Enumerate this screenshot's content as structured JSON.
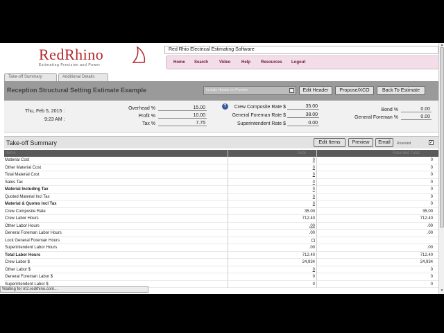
{
  "header": {
    "logo_text": "RedRhino",
    "logo_tagline": "Estimating Precision and Power",
    "brand_title": "Red Rhio Electrical Estimating Software",
    "nav": [
      "Home",
      "Search",
      "Video",
      "Help",
      "Resources",
      "Logout"
    ]
  },
  "tabs": [
    "Take-off Summary",
    "Additional Details"
  ],
  "estimate": {
    "title": "Reception Structural Setting Estimate Example",
    "include_header_label": "Include Header on Preview",
    "buttons": [
      "Edit Header",
      "Propose/XCO",
      "Back To Estimate"
    ]
  },
  "info": {
    "date": "Thu, Feb 5, 2015 :",
    "time": "9:23 AM :",
    "overhead_label": "Overhead %",
    "overhead": "15.00",
    "profit_label": "Profit %",
    "profit": "10.00",
    "tax_label": "Tax %",
    "tax": "7.75",
    "crew_rate_label": "Crew Composite Rate $",
    "crew_rate": "35.00",
    "gf_rate_label": "General Foreman Rate $",
    "gf_rate": "38.00",
    "super_rate_label": "Superintendent Rate $",
    "super_rate": "0.00",
    "bond_label": "Bond %",
    "bond": "0.00",
    "gf_pct_label": "General Foreman %",
    "gf_pct": "0.00"
  },
  "summary": {
    "title": "Take-off Summary",
    "buttons": [
      "Edit Items",
      "Preview",
      "Email"
    ],
    "rounded_label": "Rounded",
    "header_cols": [
      "Items",
      "Total",
      "Rounded Total"
    ],
    "rows": [
      {
        "name": "Material Cost",
        "v1": "0",
        "v2": "0",
        "bold": false,
        "link": true
      },
      {
        "name": "Other Material Cost",
        "v1": "0",
        "v2": "0",
        "bold": false,
        "link": true
      },
      {
        "name": "Total Material Cost",
        "v1": "0",
        "v2": "0",
        "bold": false,
        "link": true
      },
      {
        "name": "Sales Tax",
        "v1": "0",
        "v2": "0",
        "bold": false,
        "link": true
      },
      {
        "name": "Material Including Tax",
        "v1": "0",
        "v2": "0",
        "bold": true,
        "link": true
      },
      {
        "name": "Quoted Material Incl Tax",
        "v1": "0",
        "v2": "0",
        "bold": false,
        "link": true
      },
      {
        "name": "Material & Quotes Incl Tax",
        "v1": "0",
        "v2": "0",
        "bold": true,
        "link": true
      },
      {
        "name": "Crew Composite Rate",
        "v1": "35.00",
        "v2": "35.00",
        "bold": false,
        "link": false
      },
      {
        "name": "Crew Labor Hours",
        "v1": "712.40",
        "v2": "712.40",
        "bold": false,
        "link": false
      },
      {
        "name": "Other Labor Hours",
        "v1": ".00",
        "v2": ".00",
        "bold": false,
        "link": true
      },
      {
        "name": "General Foreman Labor Hours",
        "v1": ".00",
        "v2": ".00",
        "bold": false,
        "link": false
      },
      {
        "name": "Lock General Foreman Hours",
        "v1": "",
        "v2": "",
        "bold": false,
        "link": false,
        "checkbox": true
      },
      {
        "name": "Superintendent Labor Hours",
        "v1": ".00",
        "v2": ".00",
        "bold": false,
        "link": false
      },
      {
        "name": "Total Labor Hours",
        "v1": "712.40",
        "v2": "712.40",
        "bold": true,
        "link": false
      },
      {
        "name": "Crew Labor $",
        "v1": "24,934",
        "v2": "24,934",
        "bold": false,
        "link": false
      },
      {
        "name": "Other Labor $",
        "v1": "0",
        "v2": "0",
        "bold": false,
        "link": true
      },
      {
        "name": "General Foreman Labor $",
        "v1": "0",
        "v2": "0",
        "bold": false,
        "link": false
      },
      {
        "name": "Superintendent Labor $",
        "v1": "0",
        "v2": "0",
        "bold": false,
        "link": false
      }
    ]
  },
  "status_text": "Waiting for m2.redrhino.com..."
}
